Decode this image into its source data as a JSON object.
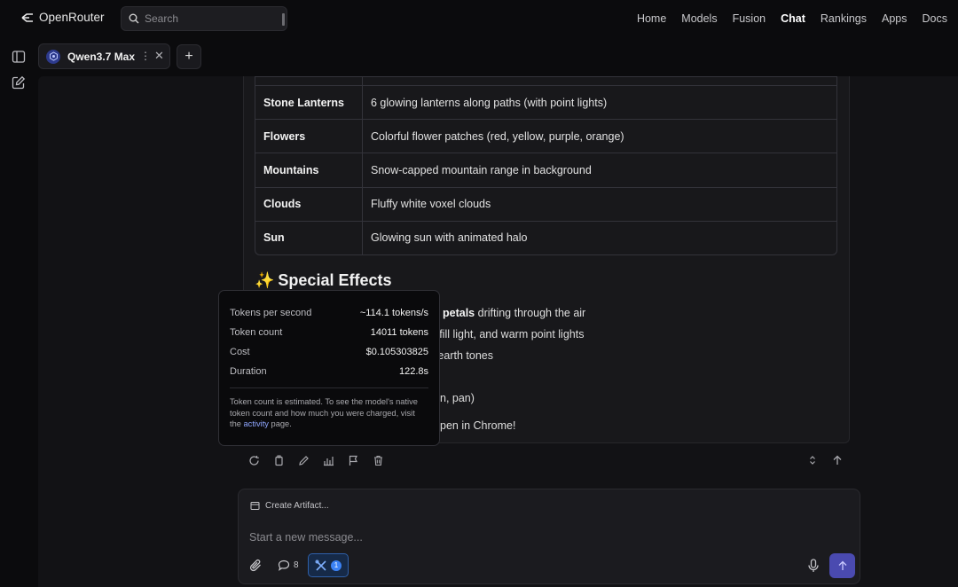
{
  "app": {
    "brand": "OpenRouter",
    "search_placeholder": "Search"
  },
  "nav": {
    "items": [
      {
        "label": "Home",
        "active": false
      },
      {
        "label": "Models",
        "active": false
      },
      {
        "label": "Fusion",
        "active": false
      },
      {
        "label": "Chat",
        "active": true
      },
      {
        "label": "Rankings",
        "active": false
      },
      {
        "label": "Apps",
        "active": false
      },
      {
        "label": "Docs",
        "active": false
      }
    ]
  },
  "sidebar": {
    "icons": [
      "sidebar-toggle-icon",
      "new-chat-icon"
    ]
  },
  "tabs": {
    "active_model": "Qwen3.7 Max",
    "add_label": "+"
  },
  "message": {
    "table": [
      {
        "key": "Stone Lanterns",
        "value": "6 glowing lanterns along paths (with point lights)"
      },
      {
        "key": "Flowers",
        "value": "Colorful flower patches (red, yellow, purple, orange)"
      },
      {
        "key": "Mountains",
        "value": "Snow-capped mountain range in background"
      },
      {
        "key": "Clouds",
        "value": "Fluffy white voxel clouds"
      },
      {
        "key": "Sun",
        "value": "Glowing sun with animated halo"
      }
    ],
    "heading_emoji": "✨",
    "heading": "Special Effects",
    "lines": {
      "l1_bold": "petals",
      "l1_rest": " drifting through the air",
      "l2": "s, fill light, and warm point lights",
      "l3": "h earth tones",
      "l4": "n, pan)",
      "l5": "pen in Chrome!"
    }
  },
  "tooltip": {
    "rows": [
      {
        "label": "Tokens per second",
        "value": "~114.1 tokens/s"
      },
      {
        "label": "Token count",
        "value": "14011 tokens"
      },
      {
        "label": "Cost",
        "value": "$0.105303825"
      },
      {
        "label": "Duration",
        "value": "122.8s"
      }
    ],
    "note_pre": "Token count is estimated. To see the model's native token count and how much you were charged, visit the ",
    "note_link": "activity",
    "note_post": " page."
  },
  "composer": {
    "artifact_label": "Create Artifact...",
    "placeholder": "Start a new message...",
    "chat_count": "8",
    "tools_badge": "1"
  },
  "colors": {
    "accent": "#4a4ab0",
    "link": "#8fa6ff",
    "tools_bg": "#162a48",
    "badge": "#3b82f6"
  }
}
